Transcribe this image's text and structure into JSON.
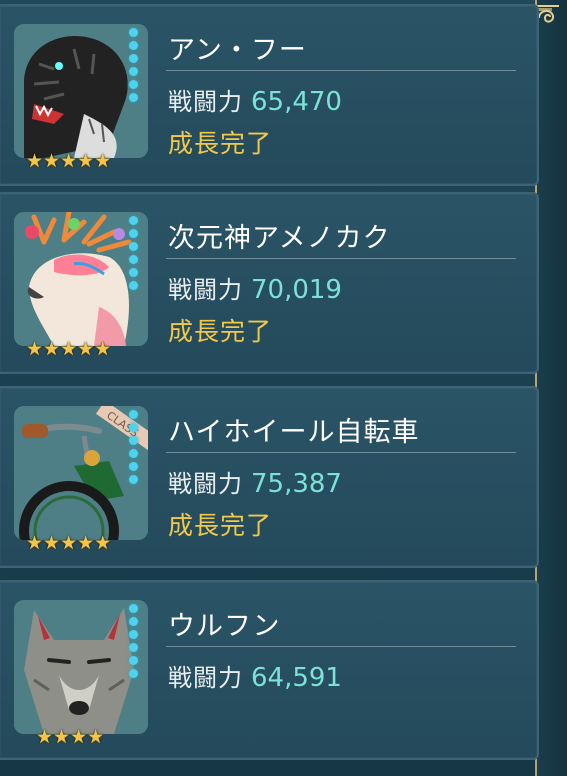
{
  "units": [
    {
      "name": "アン・フー",
      "power_label": "戦闘力",
      "power_value": "65,470",
      "status": "成長完了",
      "stars": 5,
      "portrait_icon": "black-tiger-portrait-icon"
    },
    {
      "name": "次元神アメノカク",
      "power_label": "戦闘力",
      "power_value": "70,019",
      "status": "成長完了",
      "stars": 5,
      "portrait_icon": "rainbow-deer-portrait-icon"
    },
    {
      "name": "ハイホイール自転車",
      "power_label": "戦闘力",
      "power_value": "75,387",
      "status": "成長完了",
      "stars": 5,
      "portrait_icon": "high-wheel-bicycle-portrait-icon",
      "badge_text": "CLASS"
    },
    {
      "name": "ウルフン",
      "power_label": "戦闘力",
      "power_value": "64,591",
      "status": "",
      "stars": 4,
      "portrait_icon": "gray-wolf-portrait-icon"
    }
  ],
  "colors": {
    "accent_gold": "#f2c84a",
    "power_value": "#7be3d6",
    "dot_cyan": "#4fd2ee",
    "panel_bg": "#244a5b"
  }
}
